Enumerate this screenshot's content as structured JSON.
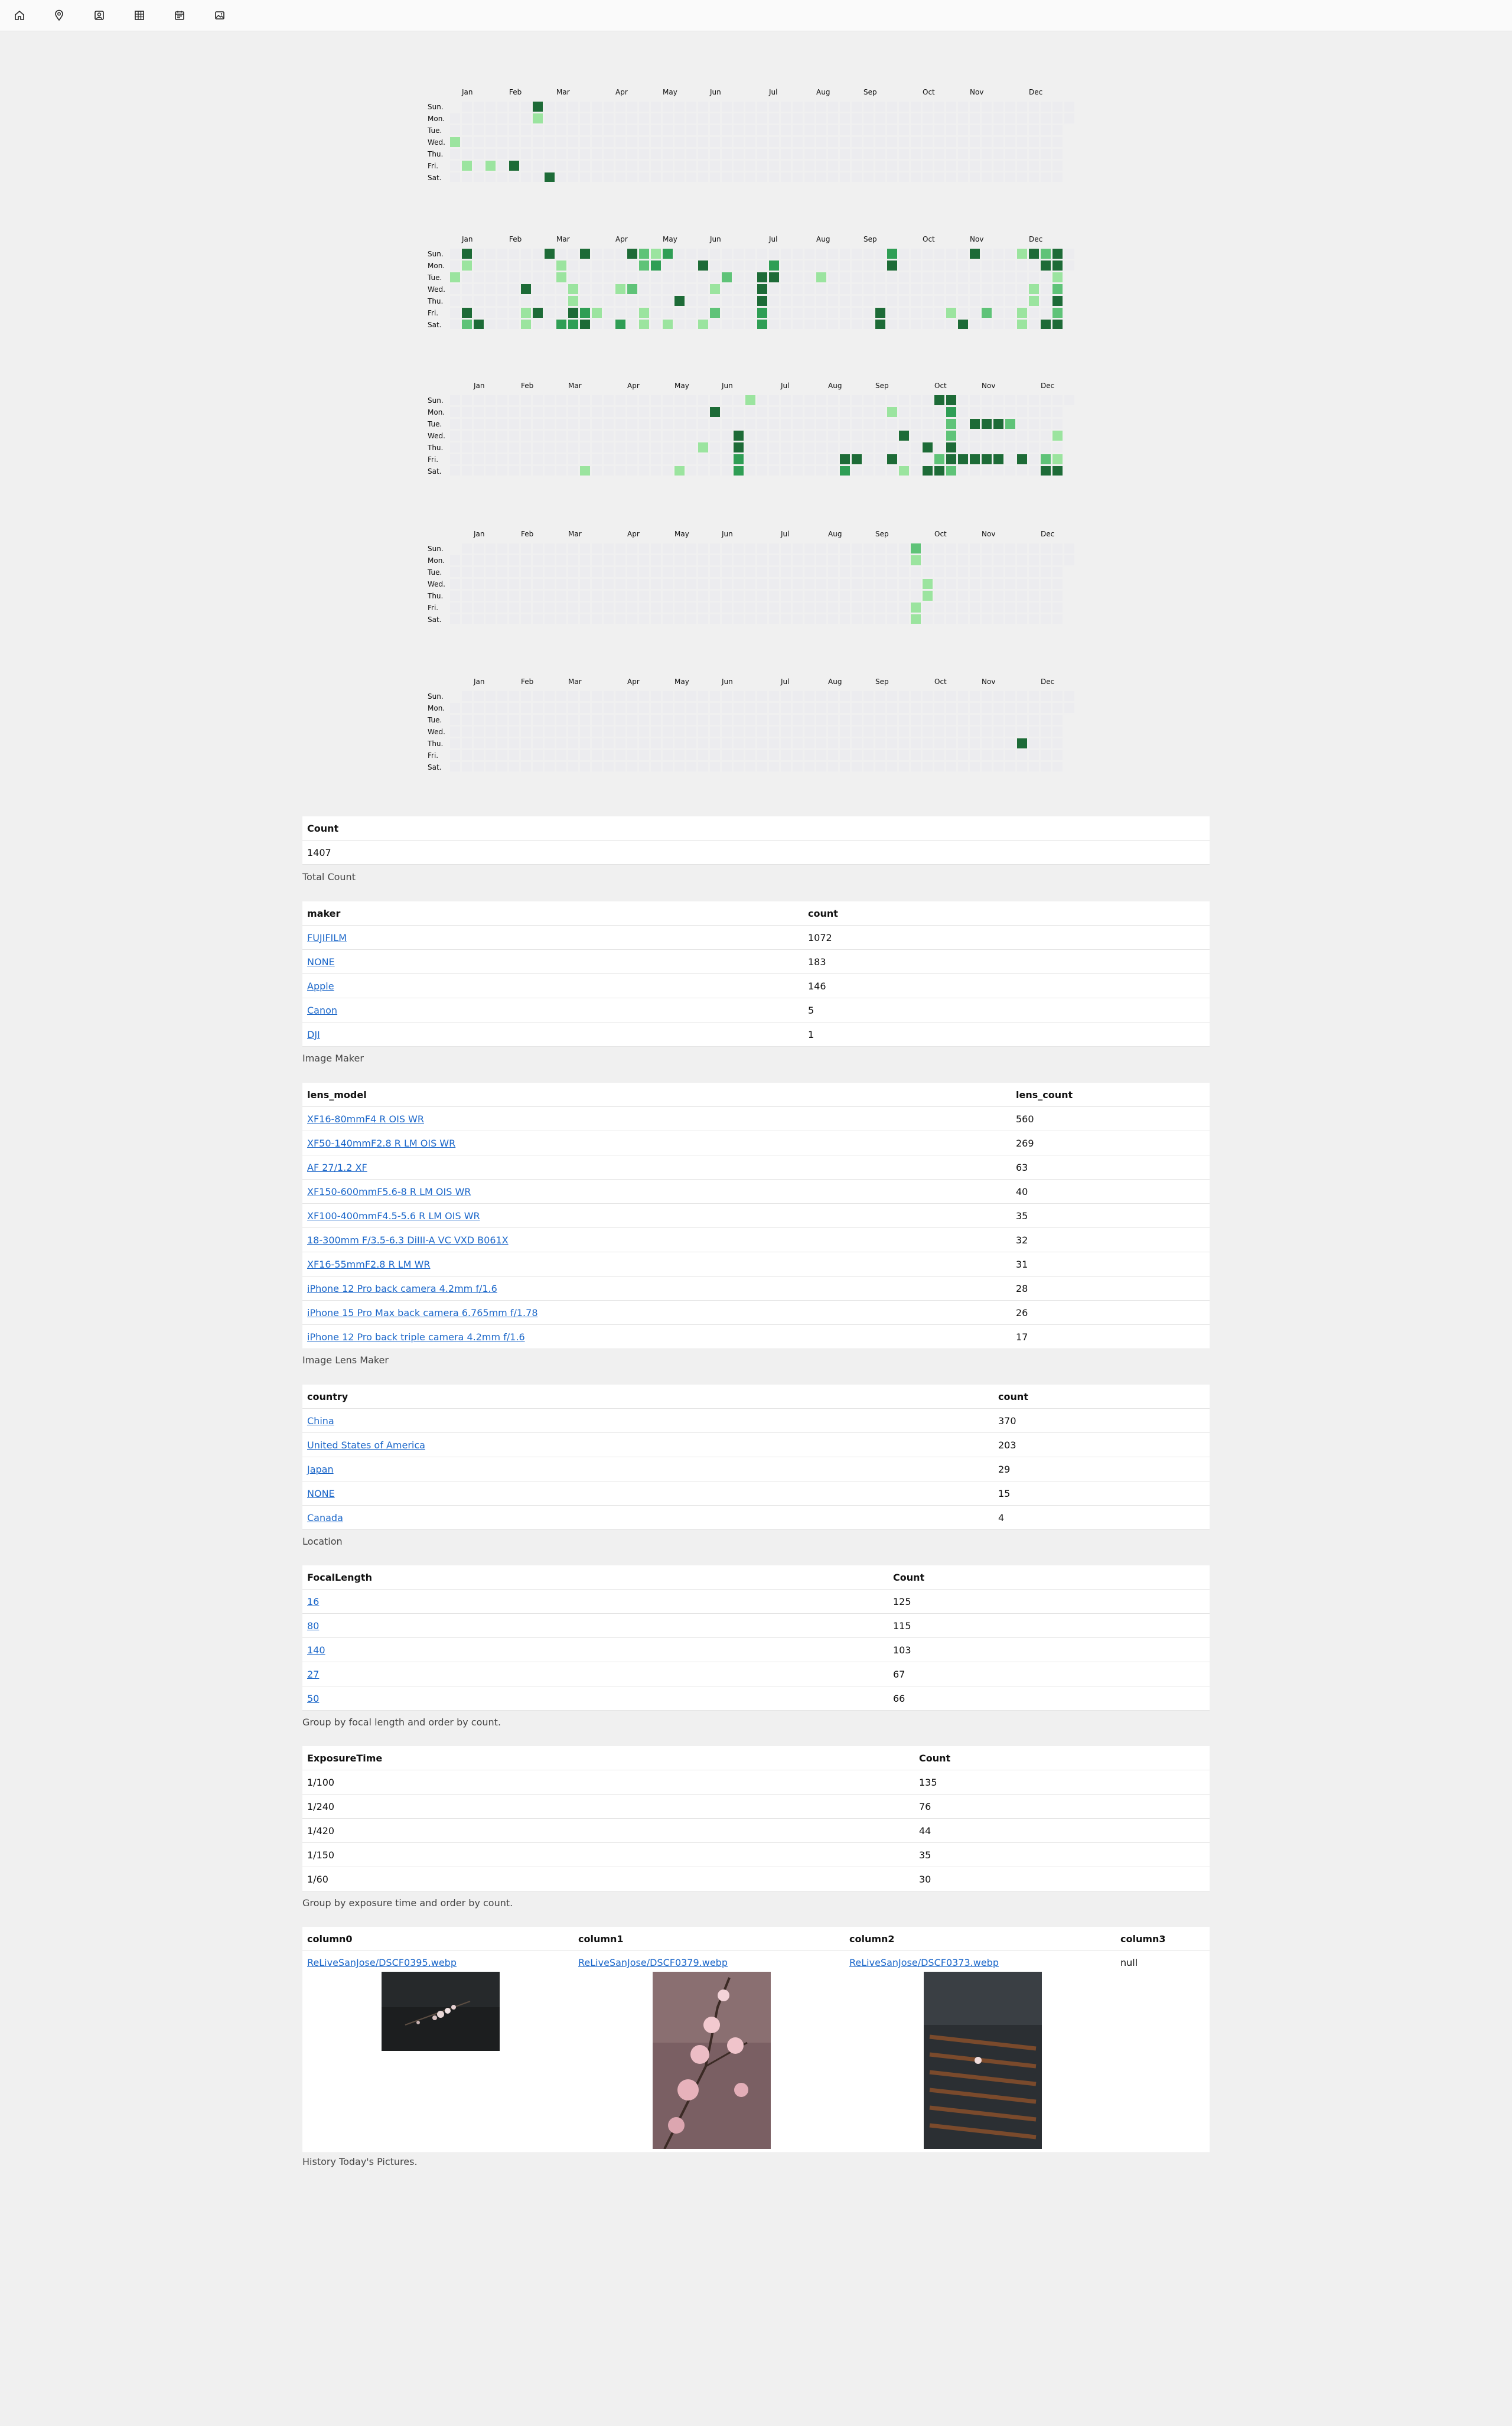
{
  "nav": [
    {
      "name": "home-icon"
    },
    {
      "name": "map-pin-icon"
    },
    {
      "name": "portrait-icon"
    },
    {
      "name": "grid-icon"
    },
    {
      "name": "calendar-icon"
    },
    {
      "name": "image-icon"
    }
  ],
  "heatmap": {
    "months": [
      "Jan",
      "Feb",
      "Mar",
      "Apr",
      "May",
      "Jun",
      "Jul",
      "Aug",
      "Sep",
      "Oct",
      "Nov",
      "Dec"
    ],
    "days": [
      "Sun.",
      "Mon.",
      "Tue.",
      "Wed.",
      "Thu.",
      "Fri.",
      "Sat."
    ],
    "colors": {
      "empty": "#ececef",
      "l1": "#9be49f",
      "l2": "#5fc378",
      "l3": "#2f9e55",
      "l4": "#1d6b37"
    },
    "years": [
      {
        "offset": 1,
        "days_in_year": 365,
        "month_weeks": [
          1,
          5,
          9,
          14,
          18,
          22,
          27,
          31,
          35,
          40,
          44,
          49
        ],
        "cells": [
          [
            7,
            0,
            4
          ],
          [
            7,
            1,
            1
          ],
          [
            0,
            3,
            1
          ],
          [
            1,
            5,
            1
          ],
          [
            3,
            5,
            1
          ],
          [
            5,
            5,
            4
          ],
          [
            8,
            6,
            4
          ]
        ]
      },
      {
        "offset": 0,
        "days_in_year": 366,
        "month_weeks": [
          1,
          5,
          9,
          14,
          18,
          22,
          27,
          31,
          35,
          40,
          44,
          49
        ],
        "cells": [
          [
            1,
            0,
            4
          ],
          [
            8,
            0,
            4
          ],
          [
            11,
            0,
            4
          ],
          [
            15,
            0,
            4
          ],
          [
            16,
            0,
            2
          ],
          [
            17,
            0,
            1
          ],
          [
            18,
            0,
            3
          ],
          [
            37,
            0,
            3
          ],
          [
            44,
            0,
            4
          ],
          [
            48,
            0,
            1
          ],
          [
            49,
            0,
            4
          ],
          [
            51,
            0,
            4
          ],
          [
            50,
            0,
            2
          ],
          [
            1,
            1,
            1
          ],
          [
            9,
            1,
            1
          ],
          [
            16,
            1,
            2
          ],
          [
            17,
            1,
            3
          ],
          [
            21,
            1,
            4
          ],
          [
            27,
            1,
            3
          ],
          [
            37,
            1,
            4
          ],
          [
            51,
            1,
            4
          ],
          [
            50,
            1,
            4
          ],
          [
            0,
            2,
            1
          ],
          [
            9,
            2,
            1
          ],
          [
            23,
            2,
            2
          ],
          [
            26,
            2,
            4
          ],
          [
            27,
            2,
            4
          ],
          [
            31,
            2,
            1
          ],
          [
            51,
            2,
            1
          ],
          [
            6,
            3,
            4
          ],
          [
            10,
            3,
            1
          ],
          [
            14,
            3,
            1
          ],
          [
            15,
            3,
            2
          ],
          [
            22,
            3,
            1
          ],
          [
            26,
            3,
            4
          ],
          [
            49,
            3,
            1
          ],
          [
            51,
            3,
            2
          ],
          [
            10,
            4,
            1
          ],
          [
            19,
            4,
            4
          ],
          [
            26,
            4,
            4
          ],
          [
            49,
            4,
            1
          ],
          [
            51,
            4,
            4
          ],
          [
            1,
            5,
            4
          ],
          [
            6,
            5,
            1
          ],
          [
            7,
            5,
            4
          ],
          [
            10,
            5,
            4
          ],
          [
            11,
            5,
            3
          ],
          [
            12,
            5,
            1
          ],
          [
            16,
            5,
            1
          ],
          [
            22,
            5,
            2
          ],
          [
            26,
            5,
            3
          ],
          [
            36,
            5,
            4
          ],
          [
            42,
            5,
            1
          ],
          [
            45,
            5,
            2
          ],
          [
            51,
            5,
            2
          ],
          [
            48,
            5,
            1
          ],
          [
            1,
            6,
            2
          ],
          [
            2,
            6,
            4
          ],
          [
            6,
            6,
            1
          ],
          [
            9,
            6,
            3
          ],
          [
            10,
            6,
            3
          ],
          [
            11,
            6,
            4
          ],
          [
            14,
            6,
            3
          ],
          [
            16,
            6,
            1
          ],
          [
            18,
            6,
            1
          ],
          [
            21,
            6,
            1
          ],
          [
            26,
            6,
            3
          ],
          [
            36,
            6,
            4
          ],
          [
            43,
            6,
            4
          ],
          [
            48,
            6,
            1
          ],
          [
            50,
            6,
            4
          ],
          [
            51,
            6,
            4
          ]
        ]
      },
      {
        "offset": 0,
        "days_in_year": 365,
        "month_weeks": [
          2,
          6,
          10,
          15,
          19,
          23,
          28,
          32,
          36,
          41,
          45,
          50
        ],
        "cells": [
          [
            25,
            0,
            1
          ],
          [
            41,
            0,
            4
          ],
          [
            42,
            0,
            4
          ],
          [
            22,
            1,
            4
          ],
          [
            37,
            1,
            1
          ],
          [
            42,
            1,
            3
          ],
          [
            42,
            2,
            2
          ],
          [
            44,
            2,
            4
          ],
          [
            45,
            2,
            4
          ],
          [
            46,
            2,
            4
          ],
          [
            47,
            2,
            2
          ],
          [
            24,
            3,
            4
          ],
          [
            38,
            3,
            4
          ],
          [
            42,
            3,
            2
          ],
          [
            51,
            3,
            1
          ],
          [
            21,
            4,
            1
          ],
          [
            24,
            4,
            4
          ],
          [
            40,
            4,
            4
          ],
          [
            42,
            4,
            4
          ],
          [
            24,
            5,
            3
          ],
          [
            33,
            5,
            4
          ],
          [
            34,
            5,
            4
          ],
          [
            37,
            5,
            4
          ],
          [
            41,
            5,
            2
          ],
          [
            42,
            5,
            4
          ],
          [
            43,
            5,
            4
          ],
          [
            44,
            5,
            4
          ],
          [
            45,
            5,
            4
          ],
          [
            46,
            5,
            4
          ],
          [
            48,
            5,
            4
          ],
          [
            50,
            5,
            2
          ],
          [
            51,
            5,
            1
          ],
          [
            11,
            6,
            1
          ],
          [
            19,
            6,
            1
          ],
          [
            24,
            6,
            3
          ],
          [
            33,
            6,
            3
          ],
          [
            38,
            6,
            1
          ],
          [
            40,
            6,
            4
          ],
          [
            41,
            6,
            4
          ],
          [
            42,
            6,
            2
          ],
          [
            50,
            6,
            4
          ],
          [
            51,
            6,
            4
          ]
        ]
      },
      {
        "offset": 1,
        "days_in_year": 365,
        "month_weeks": [
          2,
          6,
          10,
          15,
          19,
          23,
          28,
          32,
          36,
          41,
          45,
          50
        ],
        "cells": [
          [
            39,
            0,
            2
          ],
          [
            39,
            1,
            1
          ],
          [
            40,
            3,
            1
          ],
          [
            40,
            4,
            1
          ],
          [
            39,
            5,
            1
          ],
          [
            39,
            6,
            1
          ]
        ]
      },
      {
        "offset": 1,
        "days_in_year": 365,
        "month_weeks": [
          2,
          6,
          10,
          15,
          19,
          23,
          28,
          32,
          36,
          41,
          45,
          50
        ],
        "cells": [
          [
            48,
            4,
            4
          ]
        ]
      }
    ]
  },
  "tables": {
    "count": {
      "headers": [
        "Count"
      ],
      "rows": [
        [
          "1407"
        ]
      ],
      "caption": "Total Count"
    },
    "maker": {
      "headers": [
        "maker",
        "count"
      ],
      "rows": [
        [
          "FUJIFILM",
          "1072"
        ],
        [
          "NONE",
          "183"
        ],
        [
          "Apple",
          "146"
        ],
        [
          "Canon",
          "5"
        ],
        [
          "DJI",
          "1"
        ]
      ],
      "caption": "Image Maker"
    },
    "lens": {
      "headers": [
        "lens_model",
        "lens_count"
      ],
      "rows": [
        [
          "XF16-80mmF4 R OIS WR",
          "560"
        ],
        [
          "XF50-140mmF2.8 R LM OIS WR",
          "269"
        ],
        [
          "AF 27/1.2 XF",
          "63"
        ],
        [
          "XF150-600mmF5.6-8 R LM OIS WR",
          "40"
        ],
        [
          "XF100-400mmF4.5-5.6 R LM OIS WR",
          "35"
        ],
        [
          "18-300mm F/3.5-6.3 DiIII-A VC VXD B061X",
          "32"
        ],
        [
          "XF16-55mmF2.8 R LM WR",
          "31"
        ],
        [
          "iPhone 12 Pro back camera 4.2mm f/1.6",
          "28"
        ],
        [
          "iPhone 15 Pro Max back camera 6.765mm f/1.78",
          "26"
        ],
        [
          "iPhone 12 Pro back triple camera 4.2mm f/1.6",
          "17"
        ]
      ],
      "caption": "Image Lens Maker"
    },
    "country": {
      "headers": [
        "country",
        "count"
      ],
      "rows": [
        [
          "China",
          "370"
        ],
        [
          "United States of America",
          "203"
        ],
        [
          "Japan",
          "29"
        ],
        [
          "NONE",
          "15"
        ],
        [
          "Canada",
          "4"
        ]
      ],
      "caption": "Location"
    },
    "focal": {
      "headers": [
        "FocalLength",
        "Count"
      ],
      "rows": [
        [
          "16",
          "125"
        ],
        [
          "80",
          "115"
        ],
        [
          "140",
          "103"
        ],
        [
          "27",
          "67"
        ],
        [
          "50",
          "66"
        ]
      ],
      "caption": "Group by focal length and order by count."
    },
    "exposure": {
      "headers": [
        "ExposureTime",
        "Count"
      ],
      "rows": [
        [
          "1/100",
          "135"
        ],
        [
          "1/240",
          "76"
        ],
        [
          "1/420",
          "44"
        ],
        [
          "1/150",
          "35"
        ],
        [
          "1/60",
          "30"
        ]
      ],
      "caption": "Group by exposure time and order by count."
    },
    "history": {
      "headers": [
        "column0",
        "column1",
        "column2",
        "column3"
      ],
      "links": [
        "ReLiveSanJose/DSCF0395.webp",
        "ReLiveSanJose/DSCF0379.webp",
        "ReLiveSanJose/DSCF0373.webp"
      ],
      "null_text": "null",
      "caption": "History Today's Pictures."
    }
  }
}
